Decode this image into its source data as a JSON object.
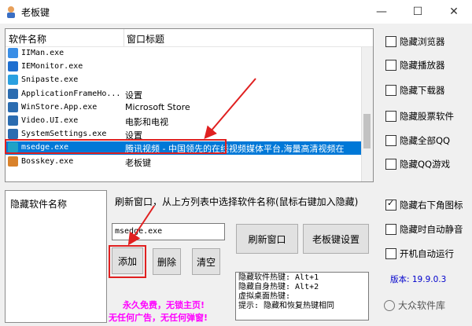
{
  "window": {
    "title": "老板键",
    "minimize": "—",
    "maximize": "☐",
    "close": "✕"
  },
  "list": {
    "col_name": "软件名称",
    "col_title": "窗口标题",
    "rows": [
      {
        "name": "IIMan.exe",
        "title": "",
        "icon_color": "#3a8ee6"
      },
      {
        "name": "IEMonitor.exe",
        "title": "",
        "icon_color": "#1e6fd0"
      },
      {
        "name": "Snipaste.exe",
        "title": "",
        "icon_color": "#2aa0e0"
      },
      {
        "name": "ApplicationFrameHo...",
        "title": "设置",
        "icon_color": "#2b6cb0"
      },
      {
        "name": "WinStore.App.exe",
        "title": "Microsoft Store",
        "icon_color": "#2b6cb0"
      },
      {
        "name": "Video.UI.exe",
        "title": "电影和电视",
        "icon_color": "#2b6cb0"
      },
      {
        "name": "SystemSettings.exe",
        "title": "设置",
        "icon_color": "#2b6cb0"
      },
      {
        "name": "msedge.exe",
        "title": "腾讯视频 - 中国领先的在线视频媒体平台,海量高清视频在",
        "icon_color": "#1fa2c6",
        "selected": true
      },
      {
        "name": "Bosskey.exe",
        "title": "老板键",
        "icon_color": "#d9822b"
      }
    ]
  },
  "options": [
    {
      "label": "隐藏浏览器",
      "checked": false
    },
    {
      "label": "隐藏播放器",
      "checked": false
    },
    {
      "label": "隐藏下载器",
      "checked": false
    },
    {
      "label": "隐藏股票软件",
      "checked": false
    },
    {
      "label": "隐藏全部QQ",
      "checked": false
    },
    {
      "label": "隐藏QQ游戏",
      "checked": false
    },
    {
      "label": "隐藏右下角图标",
      "checked": true
    },
    {
      "label": "隐藏时自动静音",
      "checked": false
    },
    {
      "label": "开机自动运行",
      "checked": false
    }
  ],
  "hidden_list": {
    "header": "隐藏软件名称"
  },
  "instruction": "刷新窗口，从上方列表中选择软件名称(鼠标右键加入隐藏)",
  "input": {
    "value": "msedge.exe"
  },
  "buttons": {
    "refresh": "刷新窗口",
    "settings": "老板键设置",
    "add": "添加",
    "delete": "删除",
    "clear": "清空"
  },
  "hotkeys": {
    "line1": "隐藏软件热键: Alt+1",
    "line2": "隐藏自身热键: Alt+2",
    "line3": "虚拟桌面热键:",
    "line4": "提示: 隐藏和恢复热键相同"
  },
  "version": "版本: 19.9.0.3",
  "promo": {
    "line1": "永久免费，无锁主页!",
    "line2": "无任何广告，无任何弹窗!"
  },
  "watermark": "大众软件库",
  "colors": {
    "accent": "#0078d7",
    "annotation": "#e02020",
    "promo": "#ff00ff",
    "version": "#0000cc"
  }
}
